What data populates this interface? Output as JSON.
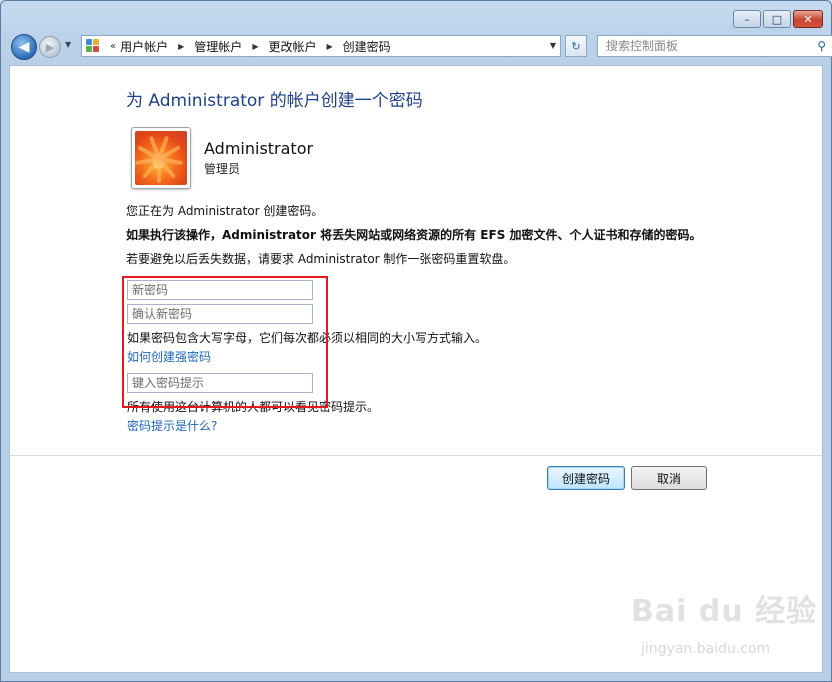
{
  "window": {
    "controls": {
      "minimize": "–",
      "maximize": "□",
      "close": "✕"
    }
  },
  "nav": {
    "back_icon": "◀",
    "forward_icon": "▶",
    "history_icon": "▼",
    "address": {
      "overflow": "«",
      "segments": [
        "用户帐户",
        "管理帐户",
        "更改帐户",
        "创建密码"
      ],
      "separator": "▶",
      "dropdown_icon": "▼"
    },
    "refresh_icon": "↻",
    "search": {
      "placeholder": "搜索控制面板",
      "icon": "⚲"
    }
  },
  "page": {
    "title": "为 Administrator 的帐户创建一个密码",
    "user": {
      "name": "Administrator",
      "role": "管理员"
    },
    "intro": "您正在为 Administrator 创建密码。",
    "warning": "如果执行该操作，Administrator 将丢失网站或网络资源的所有 EFS 加密文件、个人证书和存储的密码。",
    "advice": "若要避免以后丢失数据，请要求 Administrator 制作一张密码重置软盘。",
    "fields": {
      "new_password": "新密码",
      "confirm_password": "确认新密码",
      "hint": "键入密码提示"
    },
    "case_note": "如果密码包含大写字母，它们每次都必须以相同的大小写方式输入。",
    "strong_link": "如何创建强密码",
    "hint_note": "所有使用这台计算机的人都可以看见密码提示。",
    "hint_link": "密码提示是什么?",
    "buttons": {
      "create": "创建密码",
      "cancel": "取消"
    }
  },
  "watermark": {
    "brand": "Bai du 经验",
    "url": "jingyan.baidu.com"
  },
  "colors": {
    "title": "#1e3f8a",
    "link": "#1f67b5",
    "highlight": "#e41a1a"
  }
}
